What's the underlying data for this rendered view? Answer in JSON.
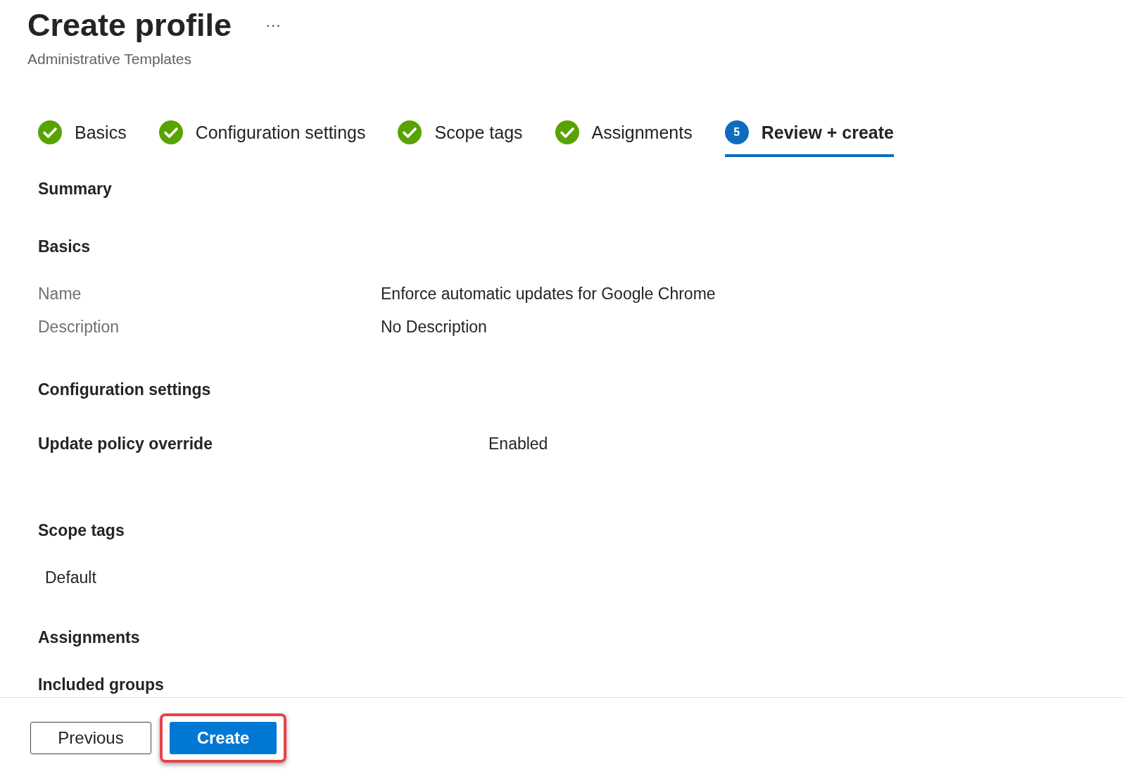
{
  "header": {
    "title": "Create profile",
    "more": "···",
    "subtitle": "Administrative Templates"
  },
  "steps": [
    {
      "label": "Basics",
      "kind": "done",
      "selected": false
    },
    {
      "label": "Configuration settings",
      "kind": "done",
      "selected": false
    },
    {
      "label": "Scope tags",
      "kind": "done",
      "selected": false
    },
    {
      "label": "Assignments",
      "kind": "done",
      "selected": false
    },
    {
      "label": "Review + create",
      "kind": "current",
      "number": "5",
      "selected": true
    }
  ],
  "summary": {
    "title": "Summary",
    "basics": {
      "title": "Basics",
      "rows": [
        {
          "label": "Name",
          "value": "Enforce automatic updates for Google Chrome"
        },
        {
          "label": "Description",
          "value": "No Description"
        }
      ]
    },
    "configuration": {
      "title": "Configuration settings",
      "settings": [
        {
          "name": "Update policy override",
          "value": "Enabled"
        }
      ]
    },
    "scope_tags": {
      "title": "Scope tags",
      "tags": [
        "Default"
      ]
    },
    "assignments": {
      "title": "Assignments",
      "subtitle": "Included groups"
    }
  },
  "footer": {
    "buttons": [
      {
        "label": "Previous",
        "kind": "secondary",
        "highlighted": false
      },
      {
        "label": "Create",
        "kind": "primary",
        "highlighted": true
      }
    ]
  }
}
